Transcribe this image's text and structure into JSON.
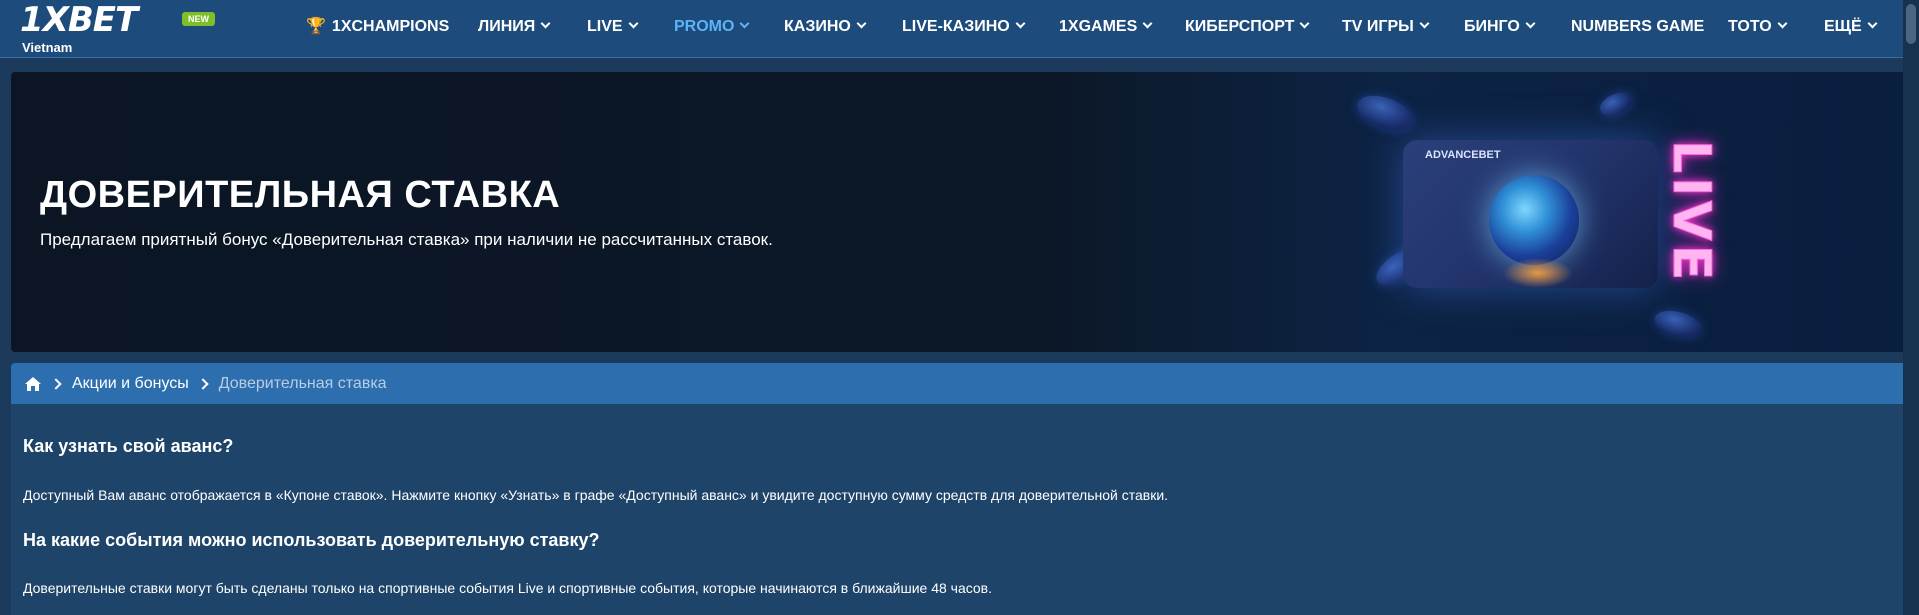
{
  "header": {
    "logo_main": "1XBET",
    "logo_country": "Vietnam",
    "new_badge": "NEW",
    "nav": [
      {
        "label": "1XCHAMPIONS",
        "dropdown": false,
        "active": false
      },
      {
        "label": "ЛИНИЯ",
        "dropdown": true,
        "active": false
      },
      {
        "label": "LIVE",
        "dropdown": true,
        "active": false
      },
      {
        "label": "PROMO",
        "dropdown": true,
        "active": true
      },
      {
        "label": "КАЗИНО",
        "dropdown": true,
        "active": false
      },
      {
        "label": "LIVE-КАЗИНО",
        "dropdown": true,
        "active": false
      },
      {
        "label": "1XGAMES",
        "dropdown": true,
        "active": false
      },
      {
        "label": "КИБЕРСПОРТ",
        "dropdown": true,
        "active": false
      },
      {
        "label": "TV ИГРЫ",
        "dropdown": true,
        "active": false
      },
      {
        "label": "БИНГО",
        "dropdown": true,
        "active": false
      },
      {
        "label": "NUMBERS GAME",
        "dropdown": false,
        "active": false
      },
      {
        "label": "ТОТО",
        "dropdown": true,
        "active": false
      },
      {
        "label": "ЕЩЁ",
        "dropdown": true,
        "active": false
      }
    ]
  },
  "banner": {
    "title": "ДОВЕРИТЕЛЬНАЯ СТАВКА",
    "subtitle": "Предлагаем приятный бонус «Доверительная ставка» при наличии не рассчитанных ставок.",
    "card_label": "ADVANCEBET",
    "neon_text": "LIVE"
  },
  "breadcrumb": {
    "items": [
      "Акции и бонусы"
    ],
    "current": "Доверительная ставка"
  },
  "content": {
    "sections": [
      {
        "heading": "Как узнать свой аванс?",
        "text": "Доступный Вам аванс отображается в «Купоне ставок». Нажмите кнопку «Узнать» в графе «Доступный аванс» и увидите доступную сумму средств для доверительной ставки."
      },
      {
        "heading": "На какие события можно использовать доверительную ставку?",
        "text": "Доверительные ставки могут быть сделаны только на спортивные события Live и спортивные события, которые начинаются в ближайшие 48 часов."
      }
    ]
  },
  "colors": {
    "header_bg": "#1c4b7c",
    "active_nav": "#5cb3f5",
    "breadcrumb_bg": "#2d6fae",
    "content_bg": "#1e4469",
    "new_badge": "#7cbf2b"
  }
}
